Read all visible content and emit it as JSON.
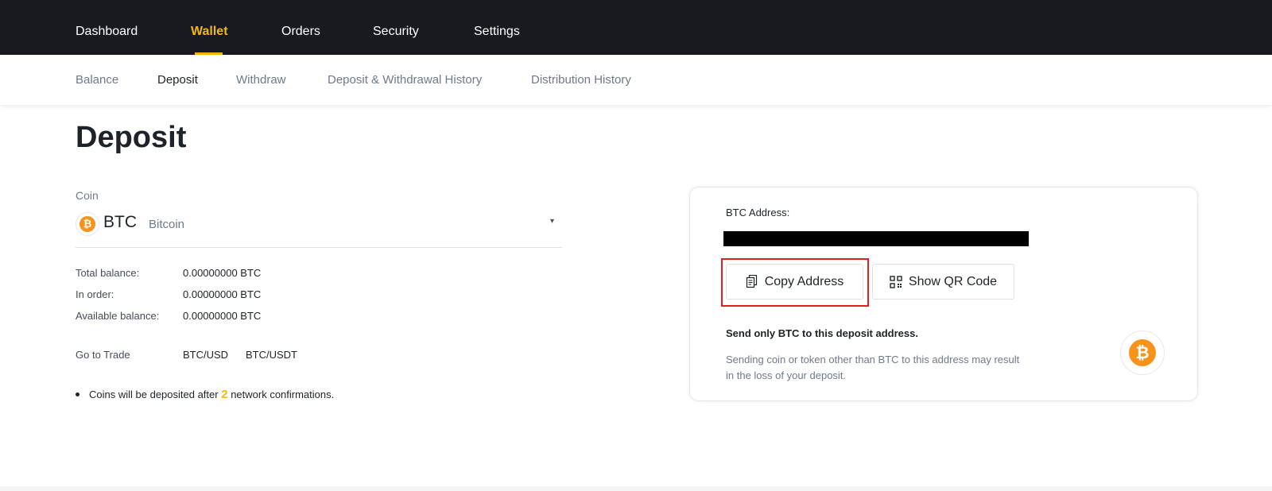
{
  "topnav": {
    "items": [
      "Dashboard",
      "Wallet",
      "Orders",
      "Security",
      "Settings"
    ],
    "active": "Wallet"
  },
  "subnav": {
    "items": [
      "Balance",
      "Deposit",
      "Withdraw",
      "Deposit & Withdrawal History",
      "Distribution History"
    ],
    "active": "Deposit"
  },
  "page": {
    "title": "Deposit"
  },
  "coin_selector": {
    "label": "Coin",
    "symbol": "BTC",
    "name": "Bitcoin",
    "icon": "bitcoin-icon",
    "caret": "▾"
  },
  "balances": {
    "total_label": "Total balance:",
    "total_value": "0.00000000 BTC",
    "order_label": "In order:",
    "order_value": "0.00000000 BTC",
    "available_label": "Available balance:",
    "available_value": "0.00000000 BTC"
  },
  "trade": {
    "label": "Go to Trade",
    "pairs": [
      "BTC/USD",
      "BTC/USDT"
    ]
  },
  "note": {
    "prefix": "Coins will be deposited after",
    "count": "2",
    "suffix": "network confirmations."
  },
  "address_card": {
    "label": "BTC Address:",
    "copy_button": "Copy Address",
    "qr_button": "Show QR Code",
    "warning_title": "Send only BTC to this deposit address.",
    "warning_text": "Sending coin or token other than BTC to this address may result in the loss of your deposit."
  },
  "colors": {
    "accent": "#f0b90b",
    "nav_bg": "#181a20",
    "bitcoin": "#f7931a",
    "highlight": "#e02020"
  }
}
